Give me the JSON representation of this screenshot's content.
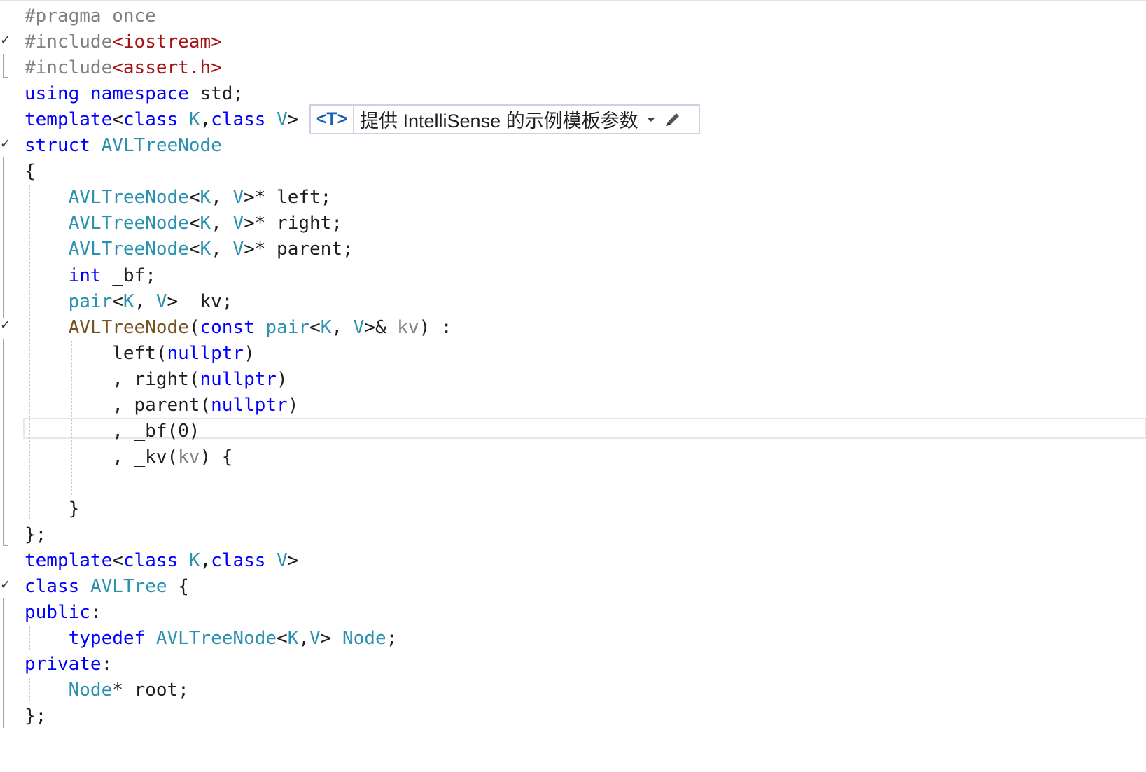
{
  "editor": {
    "fold_glyph": "✓",
    "template_bar": {
      "badge": "<T>",
      "label": "提供 IntelliSense 的示例模板参数",
      "dropdown_icon": "chevron-down-icon",
      "edit_icon": "pencil-icon"
    },
    "lines": [
      [
        {
          "t": "#pragma once",
          "c": "pre"
        }
      ],
      [
        {
          "t": "#include",
          "c": "pre"
        },
        {
          "t": "<iostream>",
          "c": "inc"
        }
      ],
      [
        {
          "t": "#include",
          "c": "pre"
        },
        {
          "t": "<assert.h>",
          "c": "inc"
        }
      ],
      [
        {
          "t": "using namespace",
          "c": "kw"
        },
        {
          "t": " std;",
          "c": "plain"
        }
      ],
      [
        {
          "t": "template",
          "c": "kw"
        },
        {
          "t": "<",
          "c": "plain"
        },
        {
          "t": "class",
          "c": "kw"
        },
        {
          "t": " ",
          "c": "plain"
        },
        {
          "t": "K",
          "c": "typ"
        },
        {
          "t": ",",
          "c": "plain"
        },
        {
          "t": "class",
          "c": "kw"
        },
        {
          "t": " ",
          "c": "plain"
        },
        {
          "t": "V",
          "c": "typ"
        },
        {
          "t": ">",
          "c": "plain"
        }
      ],
      [
        {
          "t": "struct",
          "c": "kw"
        },
        {
          "t": " ",
          "c": "plain"
        },
        {
          "t": "AVLTreeNode",
          "c": "typ"
        }
      ],
      [
        {
          "t": "{",
          "c": "plain"
        }
      ],
      [
        {
          "t": "    ",
          "c": "plain"
        },
        {
          "t": "AVLTreeNode",
          "c": "typ"
        },
        {
          "t": "<",
          "c": "plain"
        },
        {
          "t": "K",
          "c": "typ"
        },
        {
          "t": ", ",
          "c": "plain"
        },
        {
          "t": "V",
          "c": "typ"
        },
        {
          "t": ">* left;",
          "c": "plain"
        }
      ],
      [
        {
          "t": "    ",
          "c": "plain"
        },
        {
          "t": "AVLTreeNode",
          "c": "typ"
        },
        {
          "t": "<",
          "c": "plain"
        },
        {
          "t": "K",
          "c": "typ"
        },
        {
          "t": ", ",
          "c": "plain"
        },
        {
          "t": "V",
          "c": "typ"
        },
        {
          "t": ">* right;",
          "c": "plain"
        }
      ],
      [
        {
          "t": "    ",
          "c": "plain"
        },
        {
          "t": "AVLTreeNode",
          "c": "typ"
        },
        {
          "t": "<",
          "c": "plain"
        },
        {
          "t": "K",
          "c": "typ"
        },
        {
          "t": ", ",
          "c": "plain"
        },
        {
          "t": "V",
          "c": "typ"
        },
        {
          "t": ">* parent;",
          "c": "plain"
        }
      ],
      [
        {
          "t": "    ",
          "c": "plain"
        },
        {
          "t": "int",
          "c": "kw"
        },
        {
          "t": " _bf;",
          "c": "plain"
        }
      ],
      [
        {
          "t": "    ",
          "c": "plain"
        },
        {
          "t": "pair",
          "c": "typ"
        },
        {
          "t": "<",
          "c": "plain"
        },
        {
          "t": "K",
          "c": "typ"
        },
        {
          "t": ", ",
          "c": "plain"
        },
        {
          "t": "V",
          "c": "typ"
        },
        {
          "t": "> _kv;",
          "c": "plain"
        }
      ],
      [
        {
          "t": "    ",
          "c": "plain"
        },
        {
          "t": "AVLTreeNode",
          "c": "fn"
        },
        {
          "t": "(",
          "c": "plain"
        },
        {
          "t": "const",
          "c": "kw"
        },
        {
          "t": " ",
          "c": "plain"
        },
        {
          "t": "pair",
          "c": "typ"
        },
        {
          "t": "<",
          "c": "plain"
        },
        {
          "t": "K",
          "c": "typ"
        },
        {
          "t": ", ",
          "c": "plain"
        },
        {
          "t": "V",
          "c": "typ"
        },
        {
          "t": ">& ",
          "c": "plain"
        },
        {
          "t": "kv",
          "c": "prm"
        },
        {
          "t": ") :",
          "c": "plain"
        }
      ],
      [
        {
          "t": "        left(",
          "c": "plain"
        },
        {
          "t": "nullptr",
          "c": "kw"
        },
        {
          "t": ")",
          "c": "plain"
        }
      ],
      [
        {
          "t": "        , right(",
          "c": "plain"
        },
        {
          "t": "nullptr",
          "c": "kw"
        },
        {
          "t": ")",
          "c": "plain"
        }
      ],
      [
        {
          "t": "        , parent(",
          "c": "plain"
        },
        {
          "t": "nullptr",
          "c": "kw"
        },
        {
          "t": ")",
          "c": "plain"
        }
      ],
      [
        {
          "t": "        , _bf(0)",
          "c": "plain"
        }
      ],
      [
        {
          "t": "        , _kv(",
          "c": "plain"
        },
        {
          "t": "kv",
          "c": "prm"
        },
        {
          "t": ") {",
          "c": "plain"
        }
      ],
      [
        {
          "t": "",
          "c": "plain"
        }
      ],
      [
        {
          "t": "    }",
          "c": "plain"
        }
      ],
      [
        {
          "t": "};",
          "c": "plain"
        }
      ],
      [
        {
          "t": "template",
          "c": "kw"
        },
        {
          "t": "<",
          "c": "plain"
        },
        {
          "t": "class",
          "c": "kw"
        },
        {
          "t": " ",
          "c": "plain"
        },
        {
          "t": "K",
          "c": "typ"
        },
        {
          "t": ",",
          "c": "plain"
        },
        {
          "t": "class",
          "c": "kw"
        },
        {
          "t": " ",
          "c": "plain"
        },
        {
          "t": "V",
          "c": "typ"
        },
        {
          "t": ">",
          "c": "plain"
        }
      ],
      [
        {
          "t": "class",
          "c": "kw"
        },
        {
          "t": " ",
          "c": "plain"
        },
        {
          "t": "AVLTree",
          "c": "typ"
        },
        {
          "t": " {",
          "c": "plain"
        }
      ],
      [
        {
          "t": "public",
          "c": "kw"
        },
        {
          "t": ":",
          "c": "plain"
        }
      ],
      [
        {
          "t": "    ",
          "c": "plain"
        },
        {
          "t": "typedef",
          "c": "kw"
        },
        {
          "t": " ",
          "c": "plain"
        },
        {
          "t": "AVLTreeNode",
          "c": "typ"
        },
        {
          "t": "<",
          "c": "plain"
        },
        {
          "t": "K",
          "c": "typ"
        },
        {
          "t": ",",
          "c": "plain"
        },
        {
          "t": "V",
          "c": "typ"
        },
        {
          "t": "> ",
          "c": "plain"
        },
        {
          "t": "Node",
          "c": "typ"
        },
        {
          "t": ";",
          "c": "plain"
        }
      ],
      [
        {
          "t": "private",
          "c": "kw"
        },
        {
          "t": ":",
          "c": "plain"
        }
      ],
      [
        {
          "t": "    ",
          "c": "plain"
        },
        {
          "t": "Node",
          "c": "typ"
        },
        {
          "t": "* root;",
          "c": "plain"
        }
      ],
      [
        {
          "t": "};",
          "c": "plain"
        }
      ]
    ]
  }
}
